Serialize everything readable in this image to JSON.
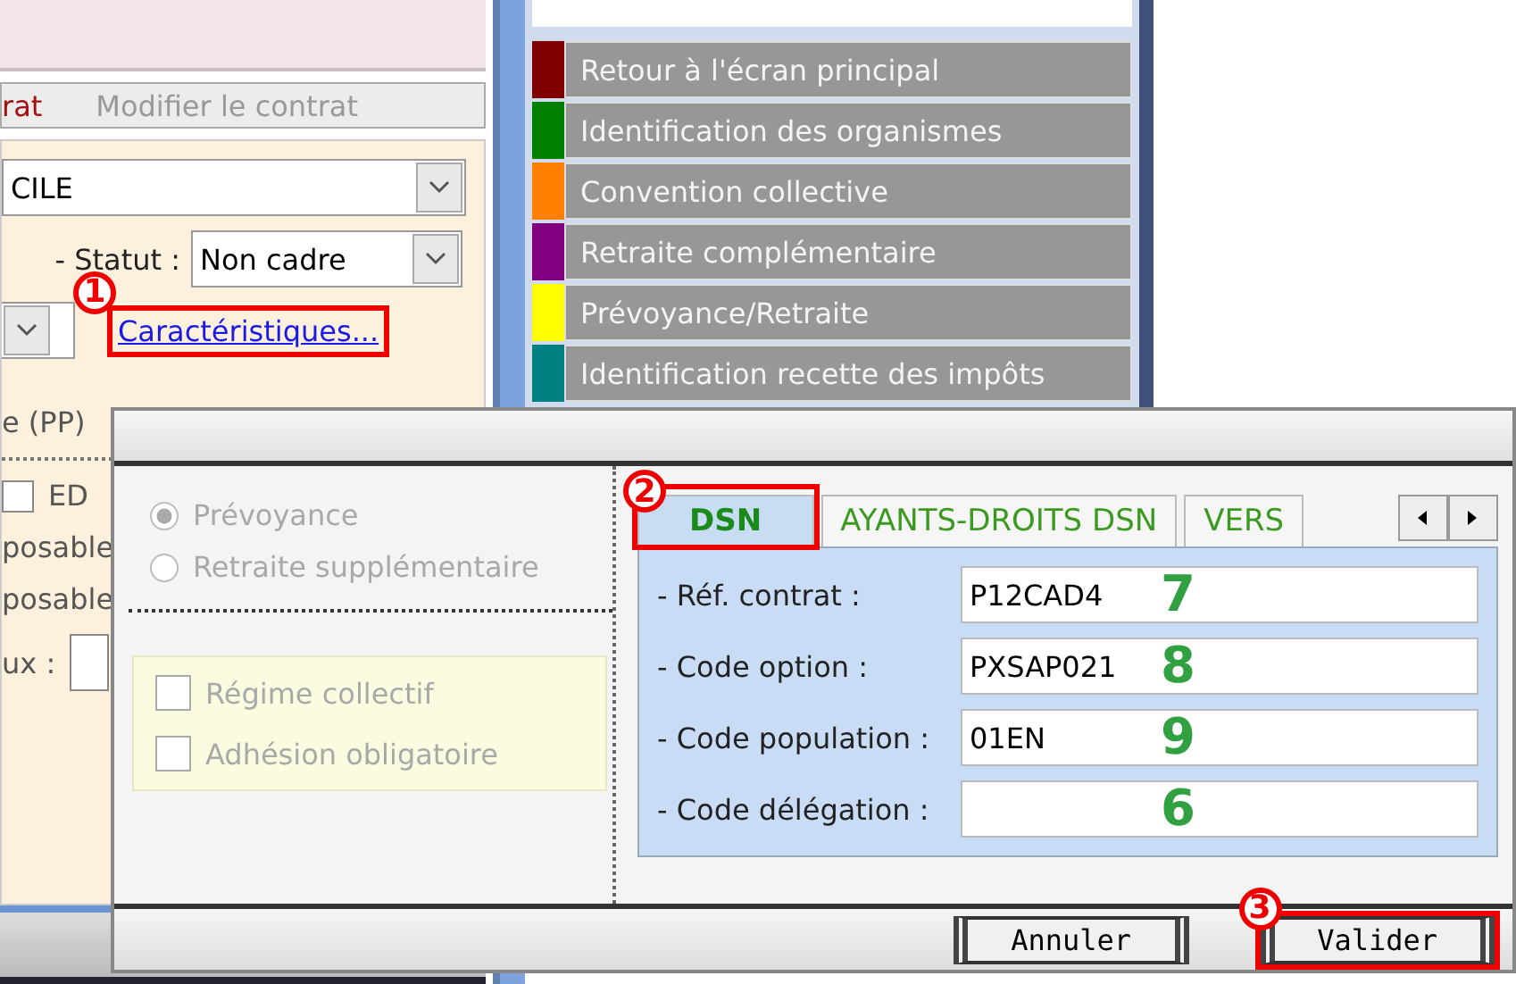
{
  "contract_form": {
    "tabs": [
      {
        "label": "rat",
        "selected": true
      },
      {
        "label": "Modifier le contrat",
        "selected": false
      }
    ],
    "regime_value": "CILE",
    "statut_label": "- Statut :",
    "statut_value": "Non cadre",
    "link": {
      "label": "Caractéristiques...",
      "callout": "1"
    },
    "labels": [
      "e (PP)",
      "ED",
      "posable",
      "posable",
      "ux :"
    ],
    "ed_checked": false
  },
  "menu": {
    "items": [
      {
        "label": "Retour à l'écran principal",
        "color": "#800000"
      },
      {
        "label": "Identification des organismes",
        "color": "#008000"
      },
      {
        "label": "Convention collective",
        "color": "#ff8000"
      },
      {
        "label": "Retraite complémentaire",
        "color": "#800080"
      },
      {
        "label": "Prévoyance/Retraite",
        "color": "#ffff00"
      },
      {
        "label": "Identification recette des impôts",
        "color": "#008080"
      }
    ]
  },
  "dialog": {
    "options": [
      {
        "label": "Prévoyance",
        "selected": true
      },
      {
        "label": "Retraite supplémentaire",
        "selected": false
      }
    ],
    "checkboxes": [
      {
        "label": "Régime collectif",
        "checked": false
      },
      {
        "label": "Adhésion obligatoire",
        "checked": false
      }
    ],
    "tabs": [
      {
        "label": "DSN",
        "selected": true,
        "callout": "2"
      },
      {
        "label": "AYANTS-DROITS DSN",
        "selected": false
      },
      {
        "label": "VERS",
        "selected": false
      }
    ],
    "fields": [
      {
        "label": "- Réf. contrat :",
        "value": "P12CAD4",
        "marker": "7"
      },
      {
        "label": "- Code option :",
        "value": "PXSAP021",
        "marker": "8"
      },
      {
        "label": "- Code population :",
        "value": "01EN",
        "marker": "9"
      },
      {
        "label": "- Code délégation :",
        "marker": "6"
      }
    ],
    "buttons": [
      {
        "label": "Annuler"
      },
      {
        "label": "Valider",
        "callout": "3"
      }
    ]
  }
}
